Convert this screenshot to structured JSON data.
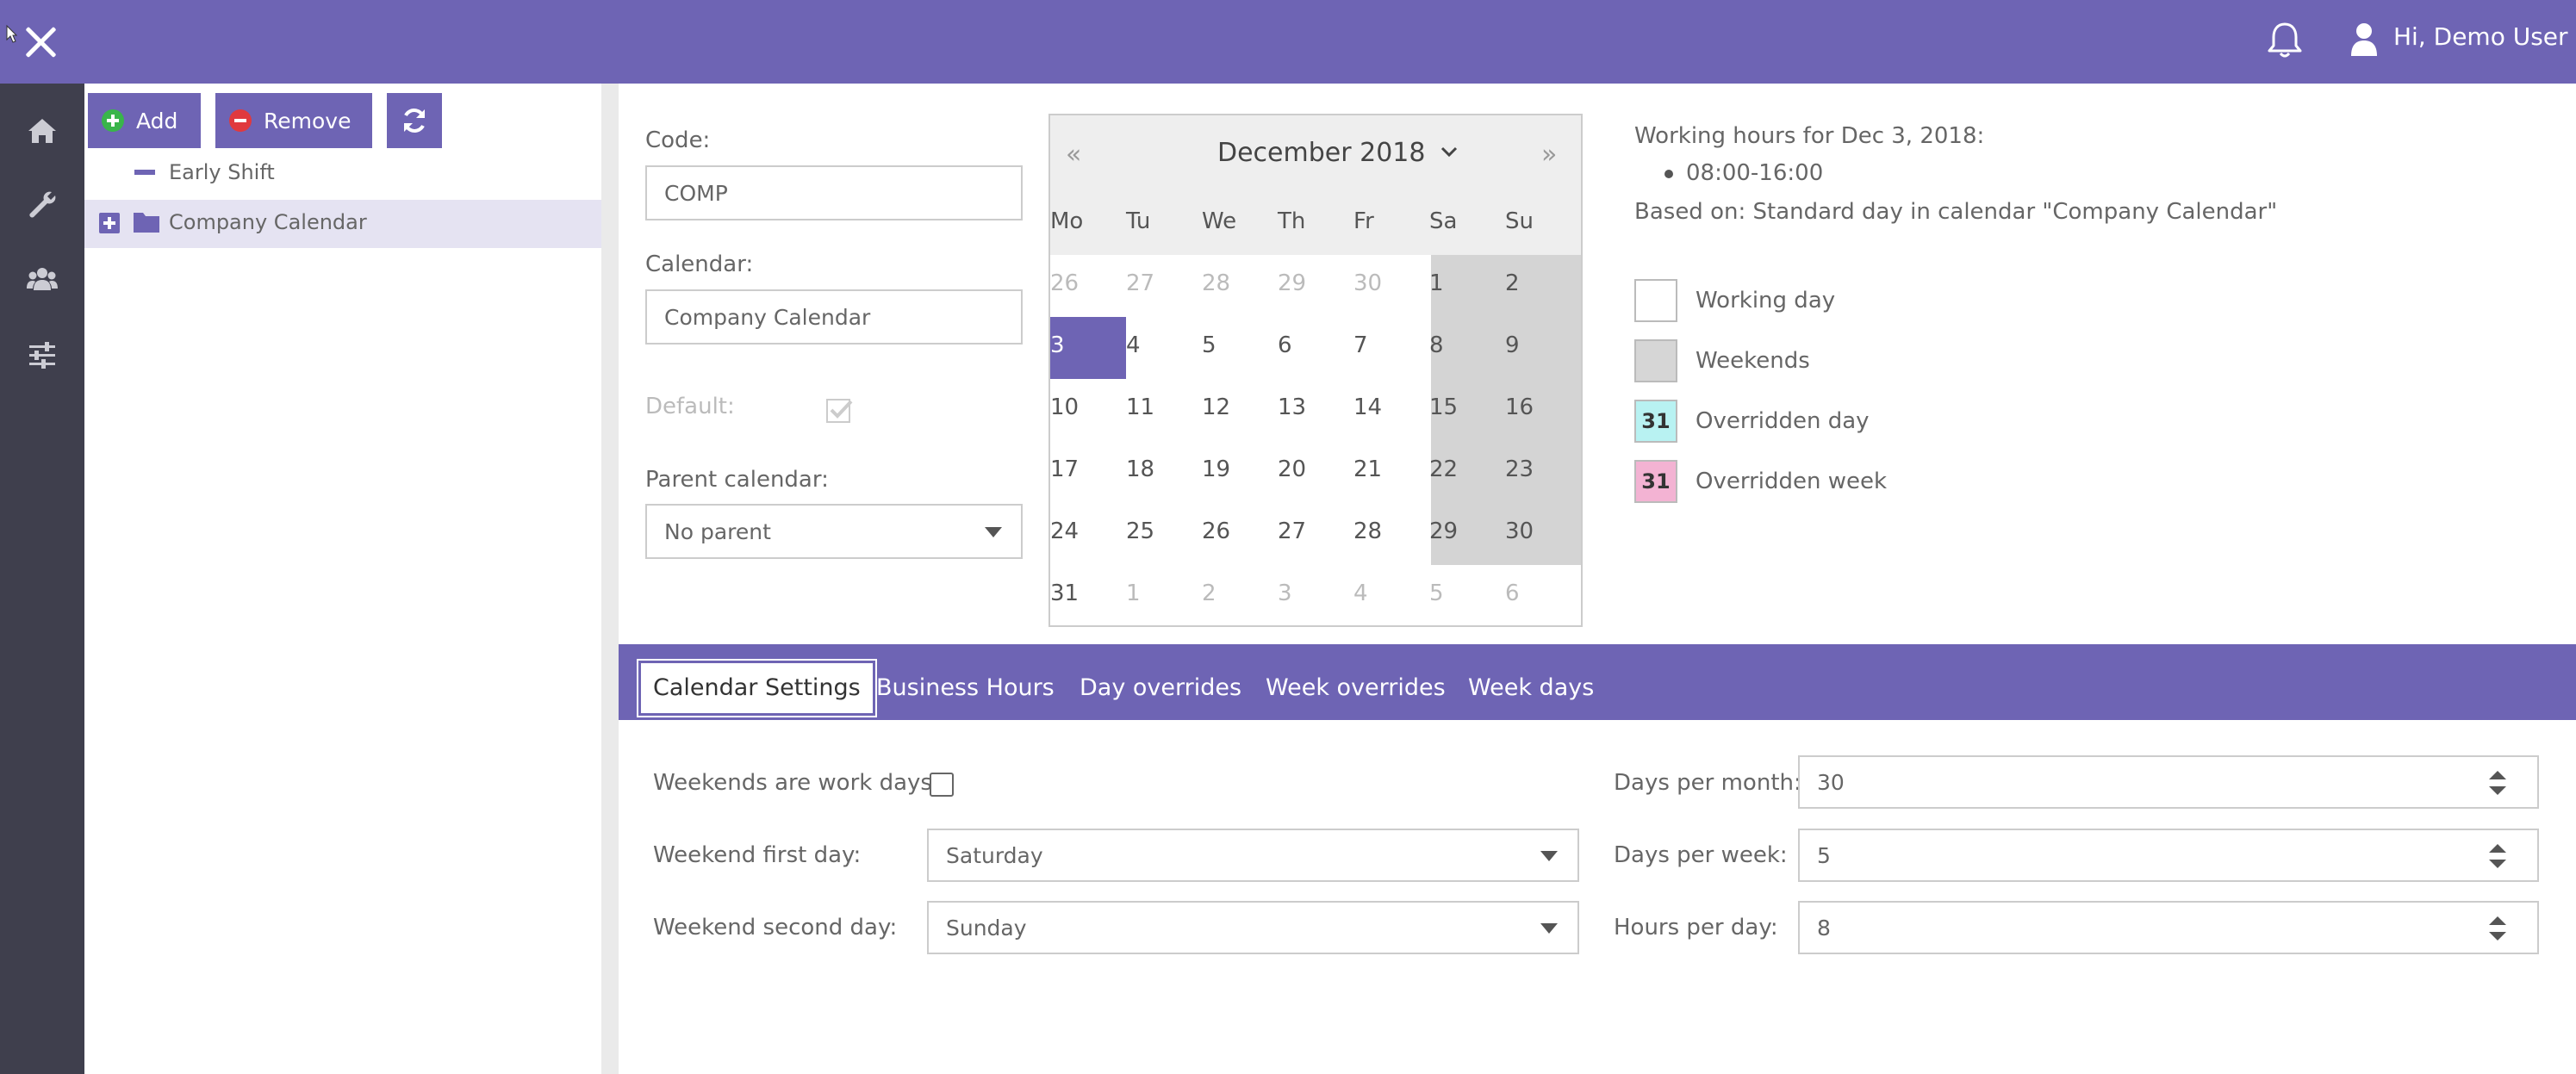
{
  "header": {
    "greeting": "Hi, Demo User"
  },
  "nav": {
    "icons": [
      "home-icon",
      "wrench-icon",
      "users-icon",
      "sliders-icon"
    ]
  },
  "toolbar": {
    "add_label": "Add",
    "remove_label": "Remove"
  },
  "tree": {
    "items": [
      {
        "label": "Early Shift"
      },
      {
        "label": "Company Calendar",
        "selected": true
      }
    ]
  },
  "form": {
    "code_label": "Code:",
    "code_value": "COMP",
    "calendar_label": "Calendar:",
    "calendar_value": "Company Calendar",
    "default_label": "Default:",
    "parent_label": "Parent calendar:",
    "parent_value": "No parent"
  },
  "calendar": {
    "title": "December 2018",
    "nav_prev": "«",
    "nav_next": "»",
    "weekdays": [
      "Mo",
      "Tu",
      "We",
      "Th",
      "Fr",
      "Sa",
      "Su"
    ],
    "weeks": [
      [
        "26",
        "27",
        "28",
        "29",
        "30",
        "1",
        "2"
      ],
      [
        "3",
        "4",
        "5",
        "6",
        "7",
        "8",
        "9"
      ],
      [
        "10",
        "11",
        "12",
        "13",
        "14",
        "15",
        "16"
      ],
      [
        "17",
        "18",
        "19",
        "20",
        "21",
        "22",
        "23"
      ],
      [
        "24",
        "25",
        "26",
        "27",
        "28",
        "29",
        "30"
      ],
      [
        "31",
        "1",
        "2",
        "3",
        "4",
        "5",
        "6"
      ]
    ],
    "selected_day": "3"
  },
  "info": {
    "working_hours_title": "Working hours for Dec 3, 2018:",
    "hours": "08:00-16:00",
    "based_on": "Based on: Standard day in calendar \"Company Calendar\""
  },
  "legend": {
    "working": "Working day",
    "weekends": "Weekends",
    "overridden_day": "Overridden day",
    "overridden_week": "Overridden week",
    "box_num": "31"
  },
  "tabs": [
    {
      "label": "Calendar Settings",
      "active": true
    },
    {
      "label": "Business Hours"
    },
    {
      "label": "Day overrides"
    },
    {
      "label": "Week overrides"
    },
    {
      "label": "Week days"
    }
  ],
  "settings": {
    "weekends_work_label": "Weekends are work days:",
    "weekend_first_label": "Weekend first day:",
    "weekend_first_value": "Saturday",
    "weekend_second_label": "Weekend second day:",
    "weekend_second_value": "Sunday",
    "days_per_month_label": "Days per month:",
    "days_per_month_value": "30",
    "days_per_week_label": "Days per week:",
    "days_per_week_value": "5",
    "hours_per_day_label": "Hours per day:",
    "hours_per_day_value": "8"
  },
  "colors": {
    "accent": "#6e64b4",
    "nav": "#3f3f4d",
    "weekend": "#d4d4d4"
  }
}
